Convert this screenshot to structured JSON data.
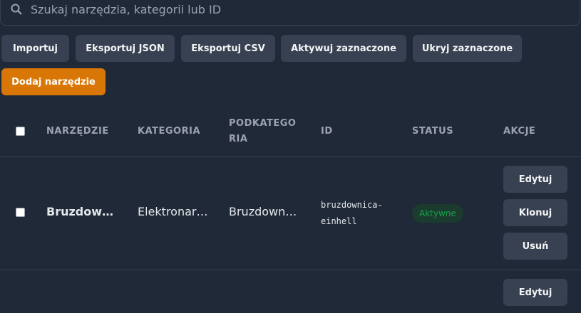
{
  "search": {
    "placeholder": "Szukaj narzędzia, kategorii lub ID",
    "value": ""
  },
  "toolbar": {
    "import": "Importuj",
    "export_json": "Eksportuj JSON",
    "export_csv": "Eksportuj CSV",
    "activate_selected": "Aktywuj zaznaczone",
    "hide_selected": "Ukryj zaznaczone",
    "add_tool": "Dodaj narzędzie"
  },
  "table": {
    "headers": {
      "tool": "NARZĘDZIE",
      "category": "KATEGORIA",
      "subcategory_1": "PODKATEGO",
      "subcategory_2": "RIA",
      "id": "ID",
      "status": "STATUS",
      "actions": "AKCJE"
    },
    "rows": [
      {
        "tool": "Bruzdownica Einhell",
        "category": "Elektronarzędzia",
        "subcategory": "Bruzdownice",
        "id_line1": "bruzdownica-",
        "id_line2": "einhell",
        "status": "Aktywne",
        "actions": {
          "edit": "Edytuj",
          "clone": "Klonuj",
          "delete": "Usuń"
        }
      },
      {
        "actions": {
          "edit": "Edytuj"
        }
      }
    ]
  },
  "colors": {
    "background": "#1f2937",
    "button": "#374151",
    "accent": "#d97706",
    "status_active": "#16a34a"
  }
}
